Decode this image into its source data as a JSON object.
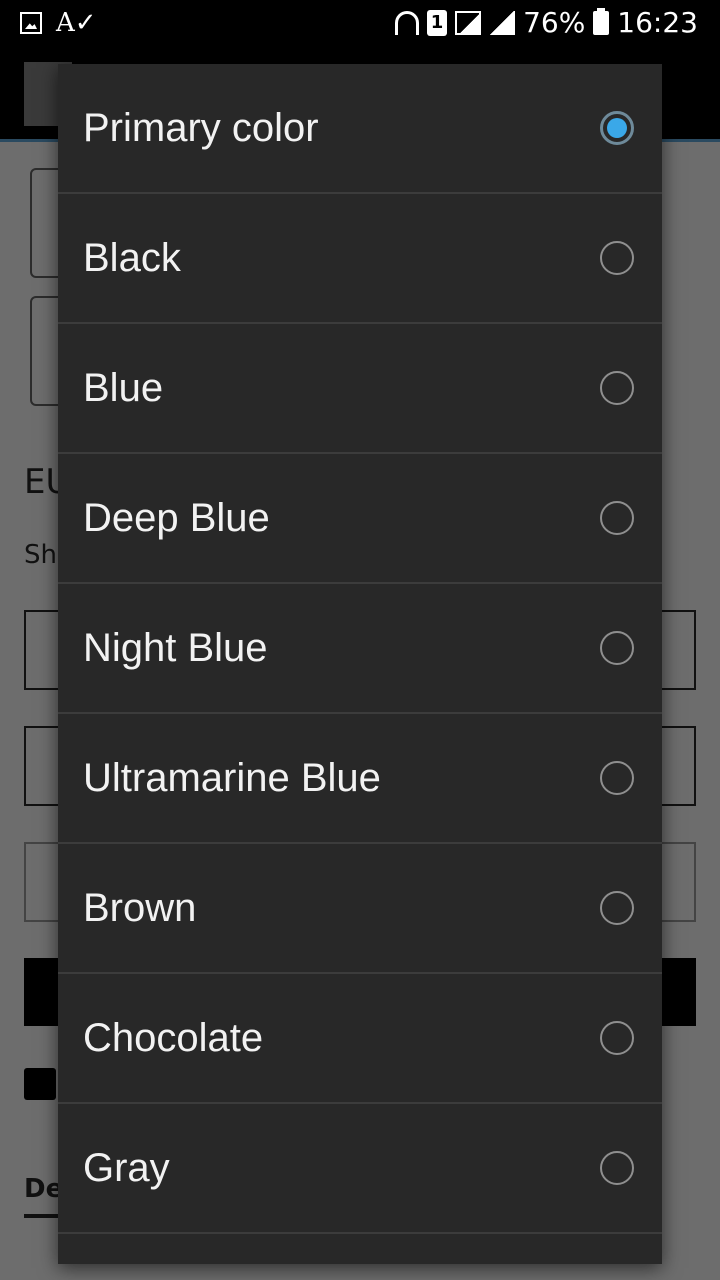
{
  "status_bar": {
    "battery_percent": "76%",
    "time": "16:23",
    "sim_number": "1",
    "icons": [
      "image-icon",
      "spellcheck-icon",
      "wifi-icon",
      "sim-icon",
      "signal-icon",
      "signal-icon",
      "battery-icon"
    ]
  },
  "background": {
    "title_fragment": "EU",
    "subtitle_fragment": "Shi",
    "tab_fragment": "De"
  },
  "dialog": {
    "options": [
      {
        "label": "Primary color",
        "selected": true
      },
      {
        "label": "Black",
        "selected": false
      },
      {
        "label": "Blue",
        "selected": false
      },
      {
        "label": "Deep Blue",
        "selected": false
      },
      {
        "label": "Night Blue",
        "selected": false
      },
      {
        "label": "Ultramarine Blue",
        "selected": false
      },
      {
        "label": "Brown",
        "selected": false
      },
      {
        "label": "Chocolate",
        "selected": false
      },
      {
        "label": "Gray",
        "selected": false
      }
    ]
  },
  "colors": {
    "dialog_bg": "#282828",
    "accent": "#3aa8e8",
    "divider": "#3c3c3c",
    "scrim": "#6d6d6d"
  }
}
